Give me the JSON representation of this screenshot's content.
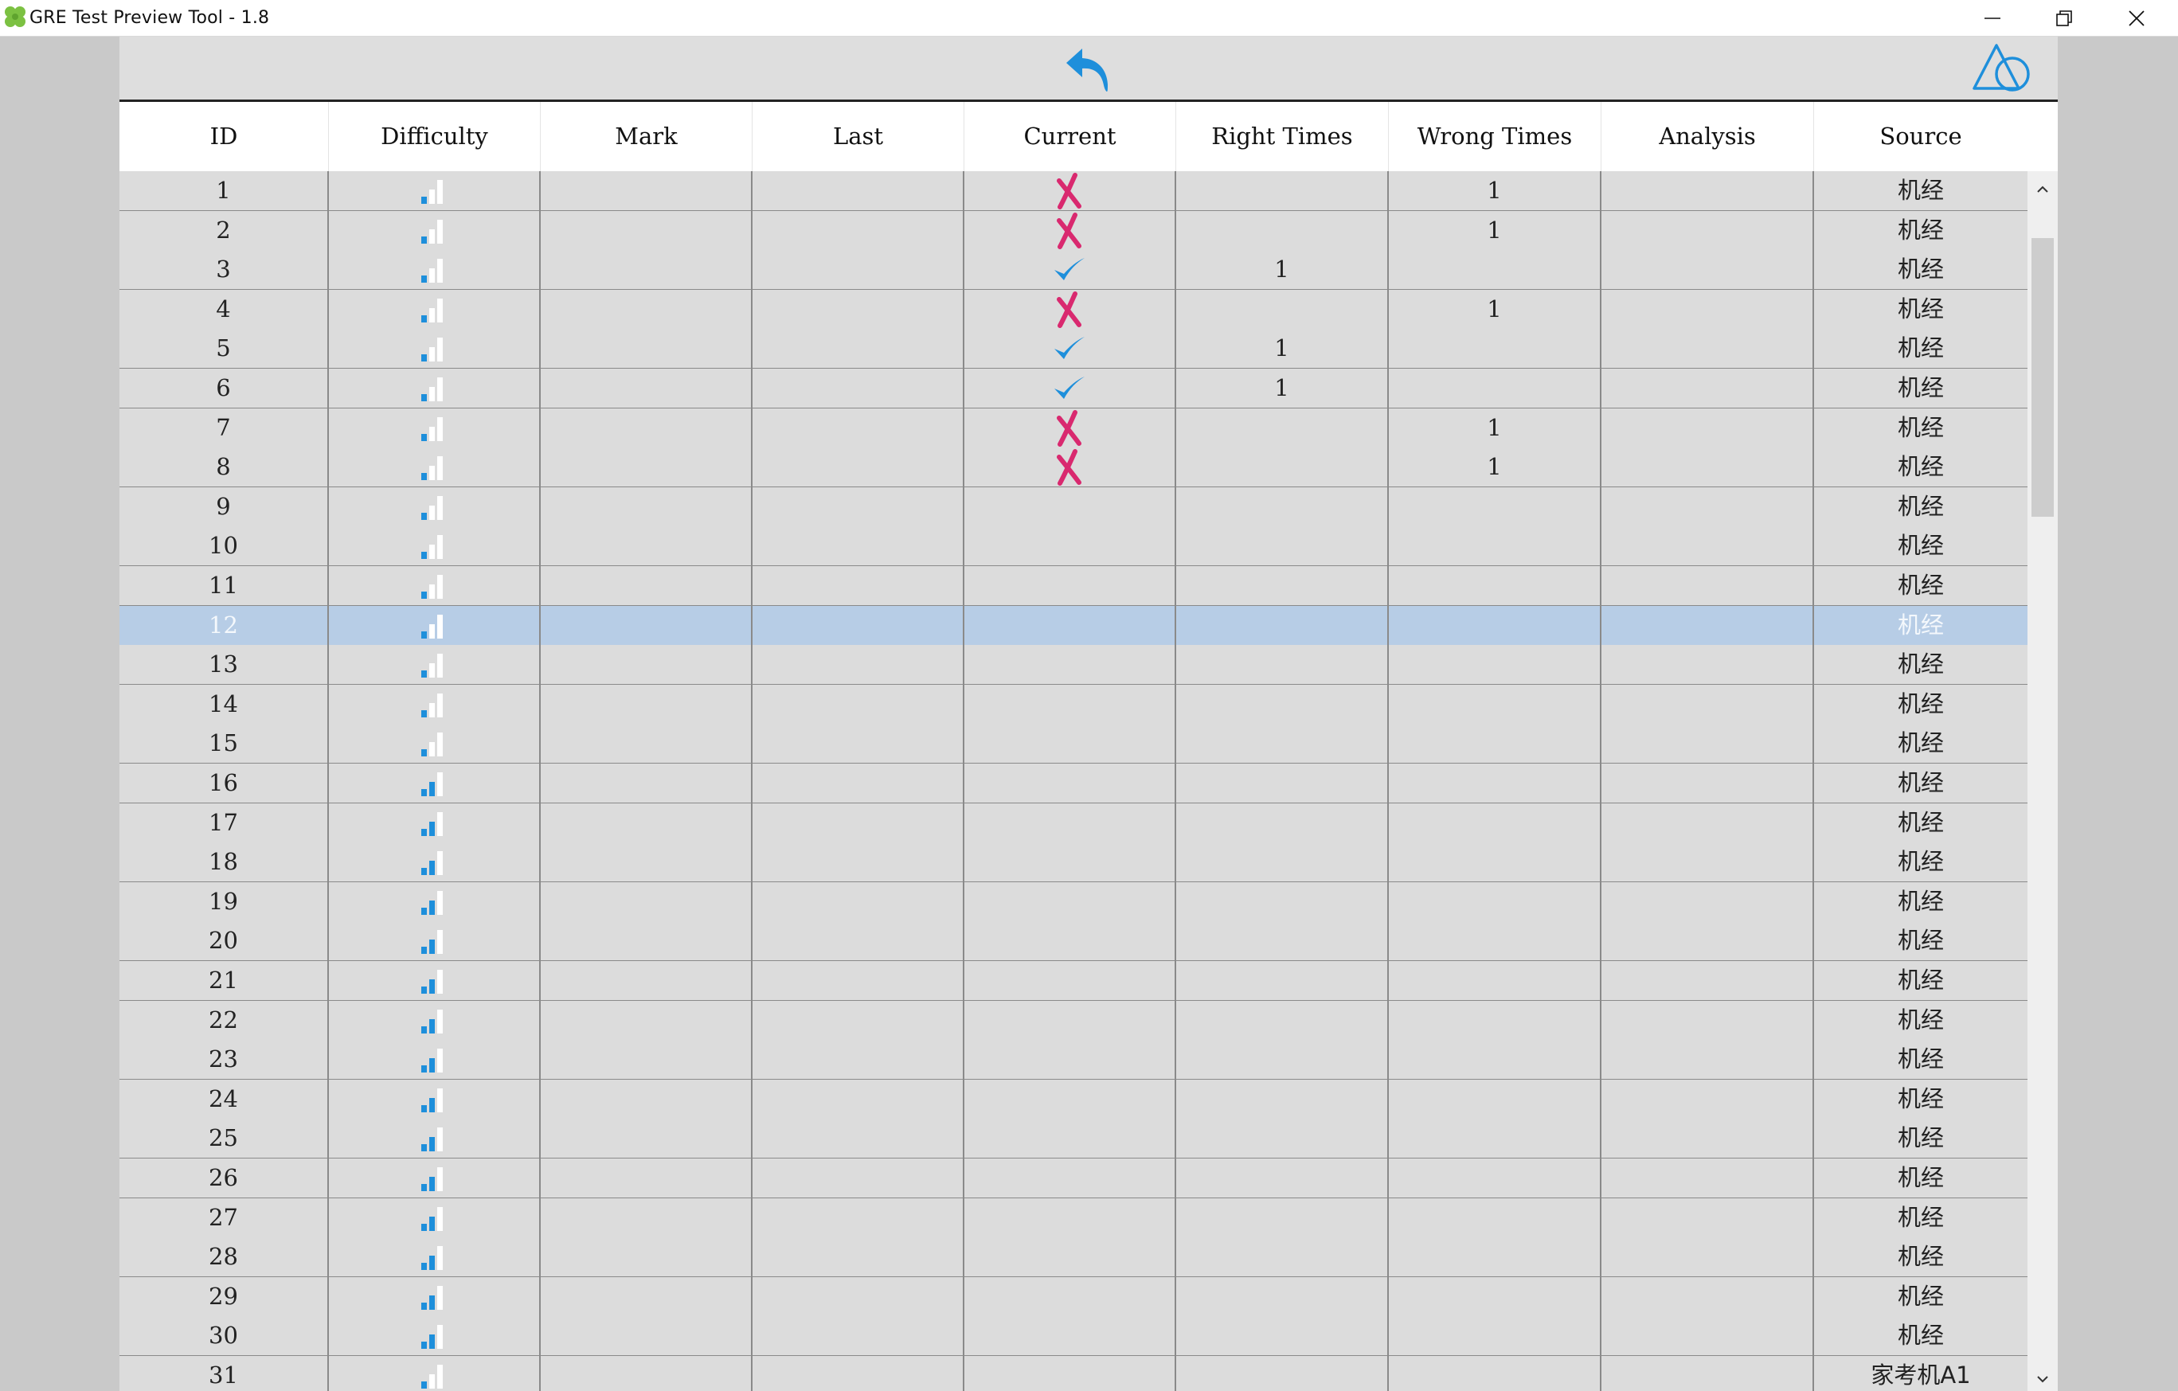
{
  "window": {
    "title": "GRE Test Preview Tool - 1.8",
    "icons": {
      "app": "clover-icon",
      "minimize": "minimize-icon",
      "maximize": "restore-icon",
      "close": "close-icon"
    }
  },
  "toolbar": {
    "back_icon": "undo-arrow-icon",
    "shape_icon": "triangle-circle-icon",
    "accent": "#1e8fdb"
  },
  "table": {
    "columns": [
      "ID",
      "Difficulty",
      "Mark",
      "Last",
      "Current",
      "Right Times",
      "Wrong Times",
      "Analysis",
      "Source"
    ],
    "selected_row_id": "12",
    "colors": {
      "right": "#3d8ed6",
      "wrong": "#e53535",
      "cross": "#d9296f",
      "check": "#1e8fdb",
      "selected": "#b7cde6"
    },
    "rows": [
      {
        "id": "1",
        "difficulty": 1,
        "mark": "",
        "last": "",
        "current": "wrong",
        "right": "",
        "wrong": "1",
        "analysis": "",
        "source": "机经"
      },
      {
        "id": "2",
        "difficulty": 1,
        "mark": "",
        "last": "",
        "current": "wrong",
        "right": "",
        "wrong": "1",
        "analysis": "",
        "source": "机经"
      },
      {
        "id": "3",
        "difficulty": 1,
        "mark": "",
        "last": "",
        "current": "right",
        "right": "1",
        "wrong": "",
        "analysis": "",
        "source": "机经"
      },
      {
        "id": "4",
        "difficulty": 1,
        "mark": "",
        "last": "",
        "current": "wrong",
        "right": "",
        "wrong": "1",
        "analysis": "",
        "source": "机经"
      },
      {
        "id": "5",
        "difficulty": 1,
        "mark": "",
        "last": "",
        "current": "right",
        "right": "1",
        "wrong": "",
        "analysis": "",
        "source": "机经"
      },
      {
        "id": "6",
        "difficulty": 1,
        "mark": "",
        "last": "",
        "current": "right",
        "right": "1",
        "wrong": "",
        "analysis": "",
        "source": "机经"
      },
      {
        "id": "7",
        "difficulty": 1,
        "mark": "",
        "last": "",
        "current": "wrong",
        "right": "",
        "wrong": "1",
        "analysis": "",
        "source": "机经"
      },
      {
        "id": "8",
        "difficulty": 1,
        "mark": "",
        "last": "",
        "current": "wrong",
        "right": "",
        "wrong": "1",
        "analysis": "",
        "source": "机经"
      },
      {
        "id": "9",
        "difficulty": 1,
        "mark": "",
        "last": "",
        "current": "",
        "right": "",
        "wrong": "",
        "analysis": "",
        "source": "机经"
      },
      {
        "id": "10",
        "difficulty": 1,
        "mark": "",
        "last": "",
        "current": "",
        "right": "",
        "wrong": "",
        "analysis": "",
        "source": "机经"
      },
      {
        "id": "11",
        "difficulty": 1,
        "mark": "",
        "last": "",
        "current": "",
        "right": "",
        "wrong": "",
        "analysis": "",
        "source": "机经"
      },
      {
        "id": "12",
        "difficulty": 1,
        "mark": "",
        "last": "",
        "current": "",
        "right": "",
        "wrong": "",
        "analysis": "",
        "source": "机经"
      },
      {
        "id": "13",
        "difficulty": 1,
        "mark": "",
        "last": "",
        "current": "",
        "right": "",
        "wrong": "",
        "analysis": "",
        "source": "机经"
      },
      {
        "id": "14",
        "difficulty": 1,
        "mark": "",
        "last": "",
        "current": "",
        "right": "",
        "wrong": "",
        "analysis": "",
        "source": "机经"
      },
      {
        "id": "15",
        "difficulty": 1,
        "mark": "",
        "last": "",
        "current": "",
        "right": "",
        "wrong": "",
        "analysis": "",
        "source": "机经"
      },
      {
        "id": "16",
        "difficulty": 2,
        "mark": "",
        "last": "",
        "current": "",
        "right": "",
        "wrong": "",
        "analysis": "",
        "source": "机经"
      },
      {
        "id": "17",
        "difficulty": 2,
        "mark": "",
        "last": "",
        "current": "",
        "right": "",
        "wrong": "",
        "analysis": "",
        "source": "机经"
      },
      {
        "id": "18",
        "difficulty": 2,
        "mark": "",
        "last": "",
        "current": "",
        "right": "",
        "wrong": "",
        "analysis": "",
        "source": "机经"
      },
      {
        "id": "19",
        "difficulty": 2,
        "mark": "",
        "last": "",
        "current": "",
        "right": "",
        "wrong": "",
        "analysis": "",
        "source": "机经"
      },
      {
        "id": "20",
        "difficulty": 2,
        "mark": "",
        "last": "",
        "current": "",
        "right": "",
        "wrong": "",
        "analysis": "",
        "source": "机经"
      },
      {
        "id": "21",
        "difficulty": 2,
        "mark": "",
        "last": "",
        "current": "",
        "right": "",
        "wrong": "",
        "analysis": "",
        "source": "机经"
      },
      {
        "id": "22",
        "difficulty": 2,
        "mark": "",
        "last": "",
        "current": "",
        "right": "",
        "wrong": "",
        "analysis": "",
        "source": "机经"
      },
      {
        "id": "23",
        "difficulty": 2,
        "mark": "",
        "last": "",
        "current": "",
        "right": "",
        "wrong": "",
        "analysis": "",
        "source": "机经"
      },
      {
        "id": "24",
        "difficulty": 2,
        "mark": "",
        "last": "",
        "current": "",
        "right": "",
        "wrong": "",
        "analysis": "",
        "source": "机经"
      },
      {
        "id": "25",
        "difficulty": 2,
        "mark": "",
        "last": "",
        "current": "",
        "right": "",
        "wrong": "",
        "analysis": "",
        "source": "机经"
      },
      {
        "id": "26",
        "difficulty": 2,
        "mark": "",
        "last": "",
        "current": "",
        "right": "",
        "wrong": "",
        "analysis": "",
        "source": "机经"
      },
      {
        "id": "27",
        "difficulty": 2,
        "mark": "",
        "last": "",
        "current": "",
        "right": "",
        "wrong": "",
        "analysis": "",
        "source": "机经"
      },
      {
        "id": "28",
        "difficulty": 2,
        "mark": "",
        "last": "",
        "current": "",
        "right": "",
        "wrong": "",
        "analysis": "",
        "source": "机经"
      },
      {
        "id": "29",
        "difficulty": 2,
        "mark": "",
        "last": "",
        "current": "",
        "right": "",
        "wrong": "",
        "analysis": "",
        "source": "机经"
      },
      {
        "id": "30",
        "difficulty": 2,
        "mark": "",
        "last": "",
        "current": "",
        "right": "",
        "wrong": "",
        "analysis": "",
        "source": "机经"
      },
      {
        "id": "31",
        "difficulty": 1,
        "mark": "",
        "last": "",
        "current": "",
        "right": "",
        "wrong": "",
        "analysis": "",
        "source": "家考机A1"
      }
    ]
  },
  "scrollbar": {
    "up_icon": "chevron-up-icon",
    "down_icon": "chevron-down-icon"
  }
}
